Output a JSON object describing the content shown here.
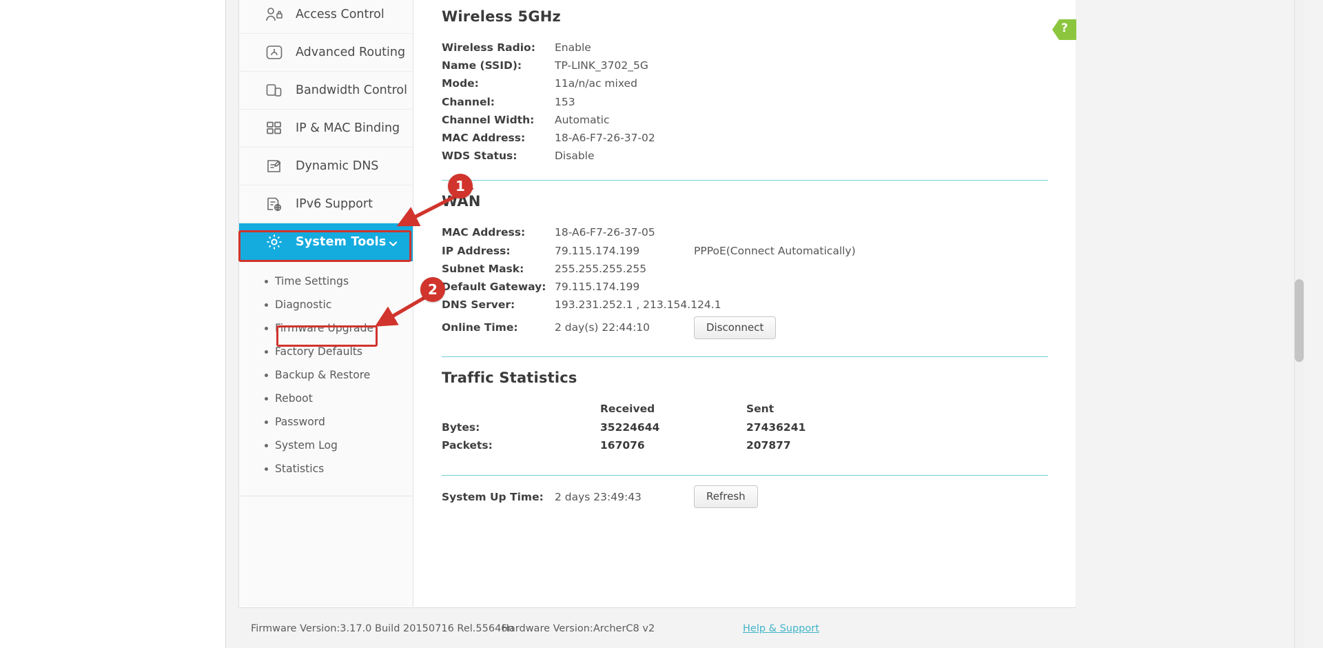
{
  "sidebar": {
    "menu": [
      {
        "label": "Access Control",
        "icon": "access-control-icon",
        "active": false
      },
      {
        "label": "Advanced Routing",
        "icon": "advanced-routing-icon",
        "active": false
      },
      {
        "label": "Bandwidth Control",
        "icon": "bandwidth-control-icon",
        "active": false
      },
      {
        "label": "IP & MAC Binding",
        "icon": "ip-mac-binding-icon",
        "active": false
      },
      {
        "label": "Dynamic DNS",
        "icon": "dynamic-dns-icon",
        "active": false
      },
      {
        "label": "IPv6 Support",
        "icon": "ipv6-support-icon",
        "active": false
      },
      {
        "label": "System Tools",
        "icon": "gear-icon",
        "active": true
      }
    ],
    "submenu": [
      "Time Settings",
      "Diagnostic",
      "Firmware Upgrade",
      "Factory Defaults",
      "Backup & Restore",
      "Reboot",
      "Password",
      "System Log",
      "Statistics"
    ]
  },
  "main": {
    "wireless": {
      "title": "Wireless 5GHz",
      "rows": [
        {
          "label": "Wireless Radio:",
          "value": "Enable"
        },
        {
          "label": "Name (SSID):",
          "value": "TP-LINK_3702_5G"
        },
        {
          "label": "Mode:",
          "value": "11a/n/ac mixed"
        },
        {
          "label": "Channel:",
          "value": "153"
        },
        {
          "label": "Channel Width:",
          "value": "Automatic"
        },
        {
          "label": "MAC Address:",
          "value": "18-A6-F7-26-37-02"
        },
        {
          "label": "WDS Status:",
          "value": "Disable"
        }
      ]
    },
    "wan": {
      "title": "WAN",
      "rows": [
        {
          "label": "MAC Address:",
          "value": "18-A6-F7-26-37-05",
          "extra": ""
        },
        {
          "label": "IP Address:",
          "value": "79.115.174.199",
          "extra": "PPPoE(Connect Automatically)"
        },
        {
          "label": "Subnet Mask:",
          "value": "255.255.255.255",
          "extra": ""
        },
        {
          "label": "Default Gateway:",
          "value": "79.115.174.199",
          "extra": ""
        },
        {
          "label": "DNS Server:",
          "value": "193.231.252.1 , 213.154.124.1",
          "extra": ""
        }
      ],
      "online_time_label": "Online Time:",
      "online_time_value": "2 day(s) 22:44:10",
      "disconnect_button": "Disconnect"
    },
    "traffic": {
      "title": "Traffic Statistics",
      "col_received": "Received",
      "col_sent": "Sent",
      "rows": [
        {
          "label": "Bytes:",
          "received": "35224644",
          "sent": "27436241"
        },
        {
          "label": "Packets:",
          "received": "167076",
          "sent": "207877"
        }
      ]
    },
    "uptime": {
      "label": "System Up Time:",
      "value": "2 days 23:49:43",
      "refresh_button": "Refresh"
    },
    "help_tab": "?"
  },
  "footer": {
    "firmware": "Firmware Version:3.17.0 Build 20150716 Rel.55646n",
    "hardware": "Hardware Version:ArcherC8 v2",
    "help_link": "Help & Support"
  },
  "annotations": {
    "step1": "1",
    "step2": "2"
  },
  "colors": {
    "accent": "#14abdf",
    "annotation": "#d0342c",
    "divider": "#6fcfd4",
    "help_green": "#8cc63f",
    "link": "#3fb4c8"
  }
}
